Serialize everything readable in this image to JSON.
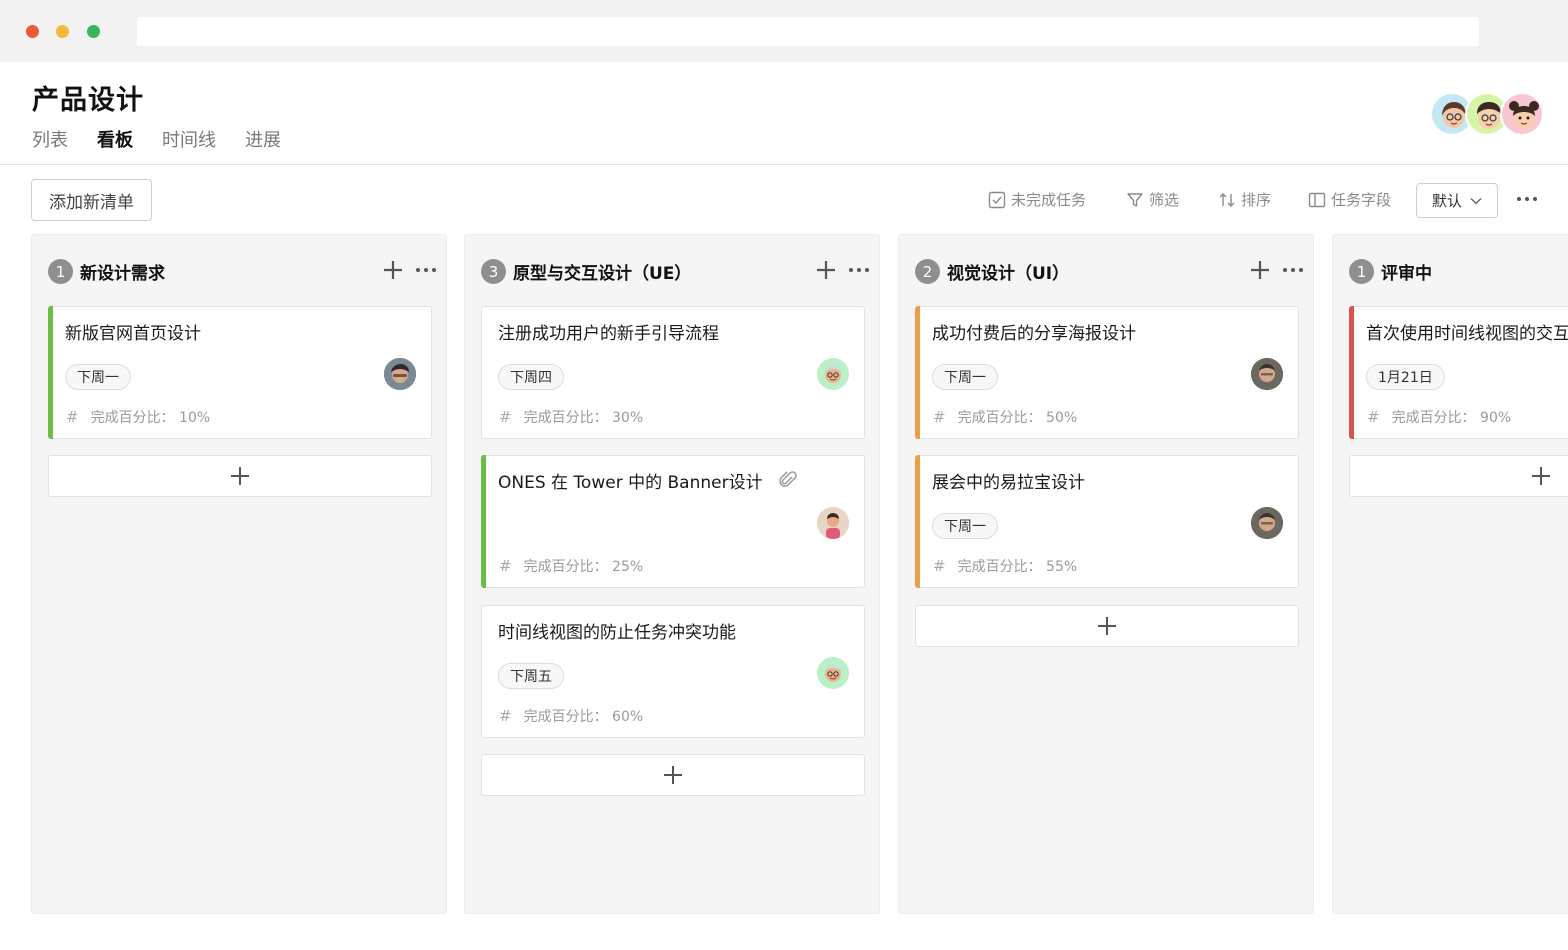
{
  "project": {
    "title": "产品设计"
  },
  "tabs": [
    {
      "label": "列表",
      "active": false
    },
    {
      "label": "看板",
      "active": true
    },
    {
      "label": "时间线",
      "active": false
    },
    {
      "label": "进展",
      "active": false
    }
  ],
  "members": [
    "avatar-woman-glasses",
    "avatar-man-curly",
    "avatar-girl-buns"
  ],
  "toolbar": {
    "add_list": "添加新清单",
    "incomplete": "未完成任务",
    "filter": "筛选",
    "sort": "排序",
    "fields": "任务字段",
    "view_select": "默认"
  },
  "columns": [
    {
      "count": "1",
      "title": "新设计需求",
      "cards": [
        {
          "title": "新版官网首页设计",
          "tag": "下周一",
          "meta_label": "完成百分比：",
          "meta_value": "10%",
          "stripe": "#6bbd45"
        }
      ]
    },
    {
      "count": "3",
      "title": "原型与交互设计（UE）",
      "cards": [
        {
          "title": "注册成功用户的新手引导流程",
          "tag": "下周四",
          "meta_label": "完成百分比：",
          "meta_value": "30%",
          "stripe": ""
        },
        {
          "title": "ONES 在 Tower 中的 Banner设计",
          "tag": "",
          "meta_label": "完成百分比：",
          "meta_value": "25%",
          "stripe": "#6bbd45"
        },
        {
          "title": "时间线视图的防止任务冲突功能",
          "tag": "下周五",
          "meta_label": "完成百分比：",
          "meta_value": "60%",
          "stripe": ""
        }
      ]
    },
    {
      "count": "2",
      "title": "视觉设计（UI）",
      "cards": [
        {
          "title": "成功付费后的分享海报设计",
          "tag": "下周一",
          "meta_label": "完成百分比：",
          "meta_value": "50%",
          "stripe": "#eaa04a"
        },
        {
          "title": "展会中的易拉宝设计",
          "tag": "下周一",
          "meta_label": "完成百分比：",
          "meta_value": "55%",
          "stripe": "#eaa04a"
        }
      ]
    },
    {
      "count": "1",
      "title": "评审中",
      "cards": [
        {
          "title": "首次使用时间线视图的交互",
          "tag": "1月21日",
          "meta_label": "完成百分比：",
          "meta_value": "90%",
          "stripe": "#d9534f"
        }
      ]
    }
  ],
  "colors": {
    "green": "#6bbd45",
    "orange": "#eaa04a",
    "red": "#d9534f"
  }
}
